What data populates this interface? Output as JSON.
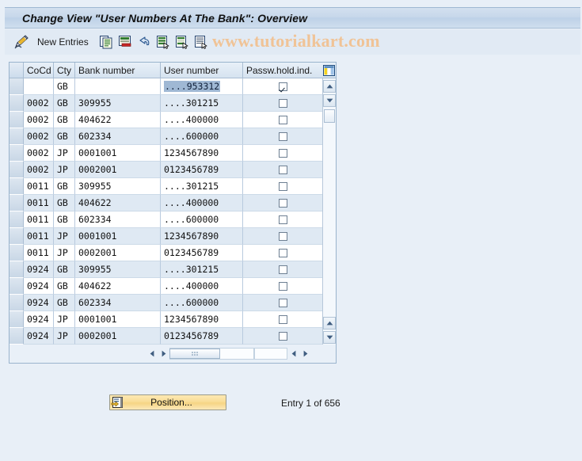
{
  "window": {
    "title": "Change View \"User Numbers At The Bank\": Overview"
  },
  "toolbar": {
    "display_change_icon": "pencil-display-change-icon",
    "new_entries_label": "New Entries",
    "icons": [
      {
        "name": "copy-as-icon"
      },
      {
        "name": "delete-icon"
      },
      {
        "name": "undo-icon"
      },
      {
        "name": "select-all-icon"
      },
      {
        "name": "deselect-all-icon"
      },
      {
        "name": "details-icon"
      }
    ]
  },
  "watermark": {
    "text": "www.tutorialkart.com",
    "color": "#f0c396"
  },
  "table": {
    "columns": [
      {
        "key": "cocd",
        "label": "CoCd"
      },
      {
        "key": "cty",
        "label": "Cty"
      },
      {
        "key": "bank",
        "label": "Bank number"
      },
      {
        "key": "usr",
        "label": "User number"
      },
      {
        "key": "pwd",
        "label": "Passw.hold.ind."
      }
    ],
    "config_icon": "column-configuration-icon",
    "rows": [
      {
        "cocd": "",
        "cty": "GB",
        "bank": "",
        "usr": "....953312",
        "pwd": true,
        "selected": true
      },
      {
        "cocd": "0002",
        "cty": "GB",
        "bank": "309955",
        "usr": "....301215",
        "pwd": false,
        "selected": false
      },
      {
        "cocd": "0002",
        "cty": "GB",
        "bank": "404622",
        "usr": "....400000",
        "pwd": false,
        "selected": false
      },
      {
        "cocd": "0002",
        "cty": "GB",
        "bank": "602334",
        "usr": "....600000",
        "pwd": false,
        "selected": false
      },
      {
        "cocd": "0002",
        "cty": "JP",
        "bank": "0001001",
        "usr": "1234567890",
        "pwd": false,
        "selected": false
      },
      {
        "cocd": "0002",
        "cty": "JP",
        "bank": "0002001",
        "usr": "0123456789",
        "pwd": false,
        "selected": false
      },
      {
        "cocd": "0011",
        "cty": "GB",
        "bank": "309955",
        "usr": "....301215",
        "pwd": false,
        "selected": false
      },
      {
        "cocd": "0011",
        "cty": "GB",
        "bank": "404622",
        "usr": "....400000",
        "pwd": false,
        "selected": false
      },
      {
        "cocd": "0011",
        "cty": "GB",
        "bank": "602334",
        "usr": "....600000",
        "pwd": false,
        "selected": false
      },
      {
        "cocd": "0011",
        "cty": "JP",
        "bank": "0001001",
        "usr": "1234567890",
        "pwd": false,
        "selected": false
      },
      {
        "cocd": "0011",
        "cty": "JP",
        "bank": "0002001",
        "usr": "0123456789",
        "pwd": false,
        "selected": false
      },
      {
        "cocd": "0924",
        "cty": "GB",
        "bank": "309955",
        "usr": "....301215",
        "pwd": false,
        "selected": false
      },
      {
        "cocd": "0924",
        "cty": "GB",
        "bank": "404622",
        "usr": "....400000",
        "pwd": false,
        "selected": false
      },
      {
        "cocd": "0924",
        "cty": "GB",
        "bank": "602334",
        "usr": "....600000",
        "pwd": false,
        "selected": false
      },
      {
        "cocd": "0924",
        "cty": "JP",
        "bank": "0001001",
        "usr": "1234567890",
        "pwd": false,
        "selected": false
      },
      {
        "cocd": "0924",
        "cty": "JP",
        "bank": "0002001",
        "usr": "0123456789",
        "pwd": false,
        "selected": false
      }
    ]
  },
  "footer": {
    "position_button_label": "Position...",
    "position_button_icon": "position-icon",
    "entry_status": "Entry 1 of 656"
  }
}
